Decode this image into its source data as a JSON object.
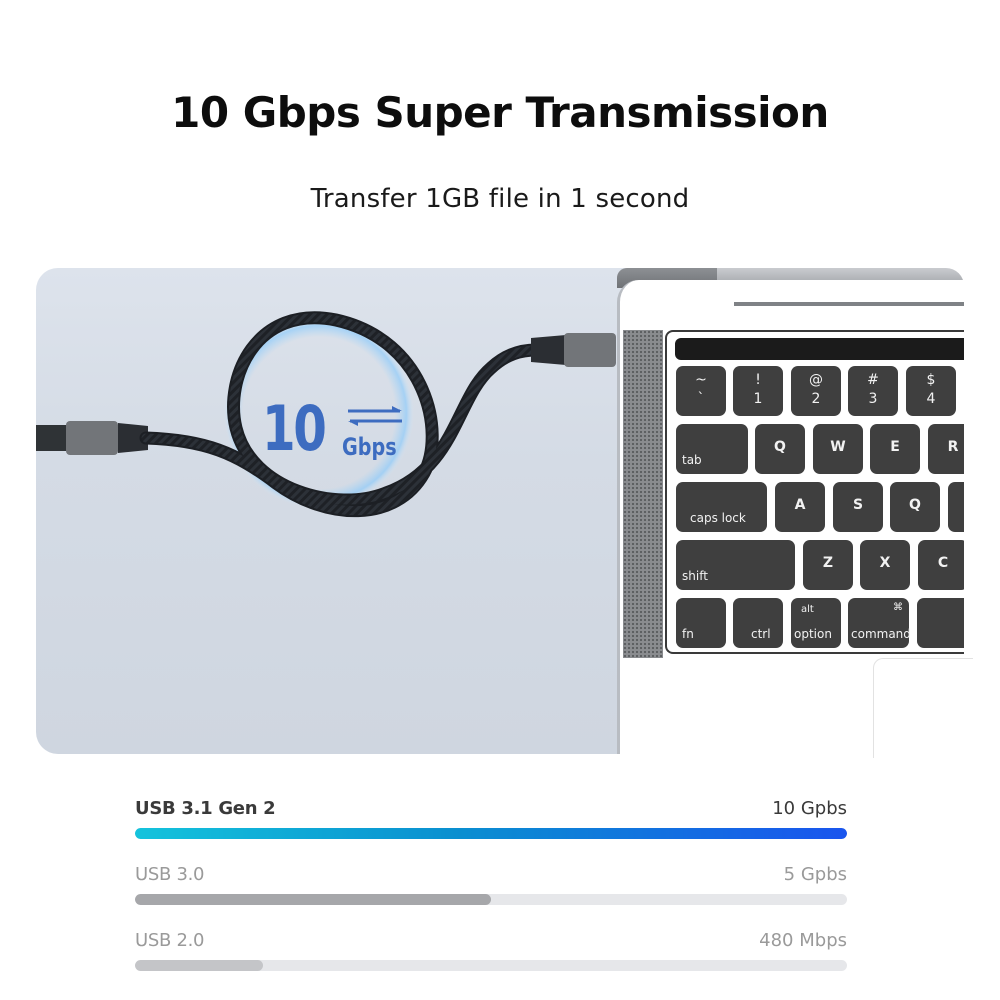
{
  "header": {
    "title": "10 Gbps Super Transmission",
    "subtitle": "Transfer 1GB file in 1 second"
  },
  "hero": {
    "badge": {
      "number": "10",
      "unit": "Gbps",
      "icon": "bidirectional-arrows-icon"
    },
    "cable_icon": "usb-c-braided-cable",
    "laptop": {
      "keyboard": {
        "row1": [
          {
            "top": "~",
            "bottom": "`"
          },
          {
            "top": "!",
            "bottom": "1"
          },
          {
            "top": "@",
            "bottom": "2"
          },
          {
            "top": "#",
            "bottom": "3"
          },
          {
            "top": "$",
            "bottom": "4"
          }
        ],
        "row2": [
          "tab",
          "Q",
          "W",
          "E",
          "R"
        ],
        "row3": [
          "caps lock",
          "A",
          "S",
          "Q",
          ""
        ],
        "row4": [
          "shift",
          "Z",
          "X",
          "C"
        ],
        "row5": [
          {
            "label": "fn"
          },
          {
            "label": "ctrl"
          },
          {
            "label": "option",
            "sub": "alt"
          },
          {
            "label": "command",
            "sub": "⌘"
          },
          {
            "label": ""
          }
        ]
      }
    }
  },
  "speeds": [
    {
      "label": "USB 3.1 Gen 2",
      "value": "10 Gpbs",
      "fill_percent": 100
    },
    {
      "label": "USB 3.0",
      "value": "5 Gpbs",
      "fill_percent": 50
    },
    {
      "label": "USB 2.0",
      "value": "480 Mbps",
      "fill_percent": 18
    }
  ],
  "colors": {
    "badge_blue": "#3d6cc0",
    "bar_gradient_start": "#14c3dc",
    "bar_gradient_end": "#1a55ee",
    "bar_gray_dark": "#a6a7aa",
    "bar_gray_light": "#c4c5c8",
    "track": "#e6e7ea"
  }
}
